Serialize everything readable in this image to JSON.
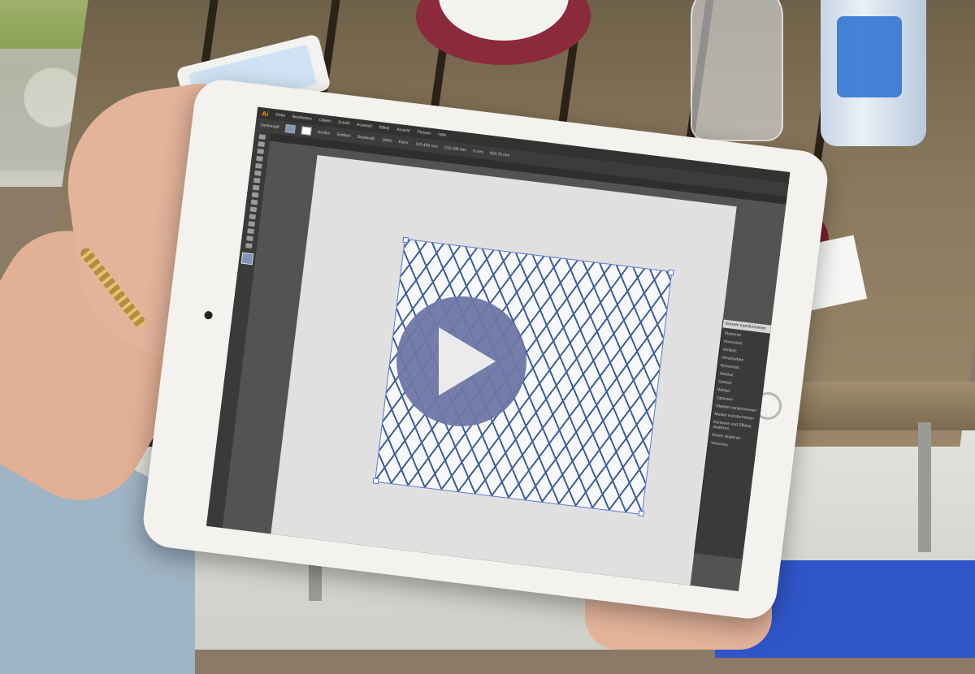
{
  "app": {
    "logo": "Ai",
    "menu": [
      "Datei",
      "Bearbeiten",
      "Objekt",
      "Schrift",
      "Auswahl",
      "Effekt",
      "Ansicht",
      "Fenster",
      "Hilfe"
    ]
  },
  "control_bar": {
    "selection_label": "Zeichenpfl",
    "stroke_label": "Kontur:",
    "uniform_label": "Einfach",
    "opacity_label": "Deckkraft:",
    "opacity_value": "100%",
    "form_label": "Form:",
    "x_value": "110,456 mm",
    "w_value": "133,336 mm",
    "angle_value": "0 mm",
    "h_value": "429,76 mm"
  },
  "document_tab": {
    "title": "Unbenannt-7* bei 142,22 % (CMYK/GPU-Vorschau)"
  },
  "transform_panel": {
    "title": "Einzeln transformieren",
    "labels": [
      "Skalieren",
      "Horizontal:",
      "Vertikal:",
      "Verschieben",
      "Horizontal:",
      "Vertikal:",
      "Drehen",
      "Winkel:",
      "Optionen",
      "Objekte transformieren",
      "Muster transformieren",
      "Konturen und Effekte skalieren",
      "Ecken skalieren",
      "Vorschau"
    ]
  },
  "colors": {
    "accent_play": "#6e76a5",
    "pattern_line": "#3e5f98",
    "ai_brand": "#ff9a00"
  },
  "icons": [
    "play-icon",
    "selection-tool-icon",
    "direct-selection-icon",
    "pen-icon",
    "type-icon",
    "hand-icon",
    "zoom-icon"
  ]
}
